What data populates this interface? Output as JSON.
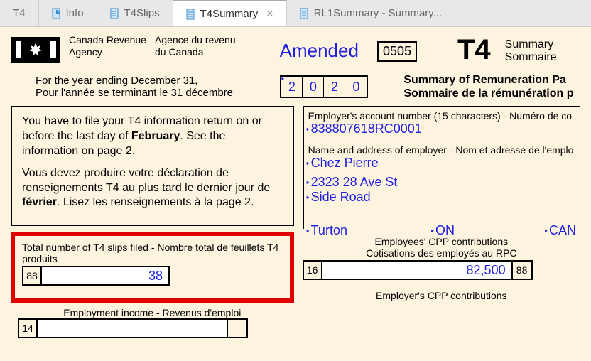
{
  "tabs": {
    "t4": "T4",
    "info": "Info",
    "slips": "T4Slips",
    "summary": "T4Summary",
    "rl1": "RL1Summary - Summary..."
  },
  "header": {
    "agency_en_1": "Canada Revenue",
    "agency_en_2": "Agency",
    "agency_fr_1": "Agence du revenu",
    "agency_fr_2": "du Canada",
    "amended": "Amended",
    "code": "0505",
    "t4": "T4",
    "summary_en": "Summary",
    "summary_fr": "Sommaire"
  },
  "year_section": {
    "label_en": "For the year ending December 31,",
    "label_fr": "Pour l'année se terminant le 31 décembre",
    "d1": "2",
    "d2": "0",
    "d3": "2",
    "d4": "0",
    "remun_en": "Summary of Remuneration Pa",
    "remun_fr": "Sommaire de la rémunération p"
  },
  "info_box": {
    "p1a": "You have to file your T4 information return on or before the last day of ",
    "p1b": "February",
    "p1c": ". See the information on page 2.",
    "p2a": "Vous devez produire votre déclaration de renseignements T4 au plus tard le dernier jour de ",
    "p2b": "février",
    "p2c": ". Lisez les renseignements à la page 2."
  },
  "line88": {
    "label": "Total number of T4 slips filed - Nombre total de feuillets T4 produits",
    "num": "88",
    "value": "38"
  },
  "line14": {
    "label": "Employment income - Revenus d'emploi",
    "num": "14"
  },
  "employer": {
    "acct_label": "Employer's account number (15 characters) - Numéro de co",
    "acct": "838807618RC0001",
    "name_label": "Name and address of employer - Nom et adresse de l'emplo",
    "name": "Chez Pierre",
    "addr1": "2323 28 Ave St",
    "addr2": "Side Road",
    "city": "Turton",
    "prov": "ON",
    "country": "CAN"
  },
  "line16": {
    "label_en": "Employees' CPP contributions",
    "label_fr": "Cotisations des employés au RPC",
    "num": "16",
    "value": "82,500",
    "suffix": "88"
  },
  "line27": {
    "label_en": "Employer's CPP contributions"
  }
}
